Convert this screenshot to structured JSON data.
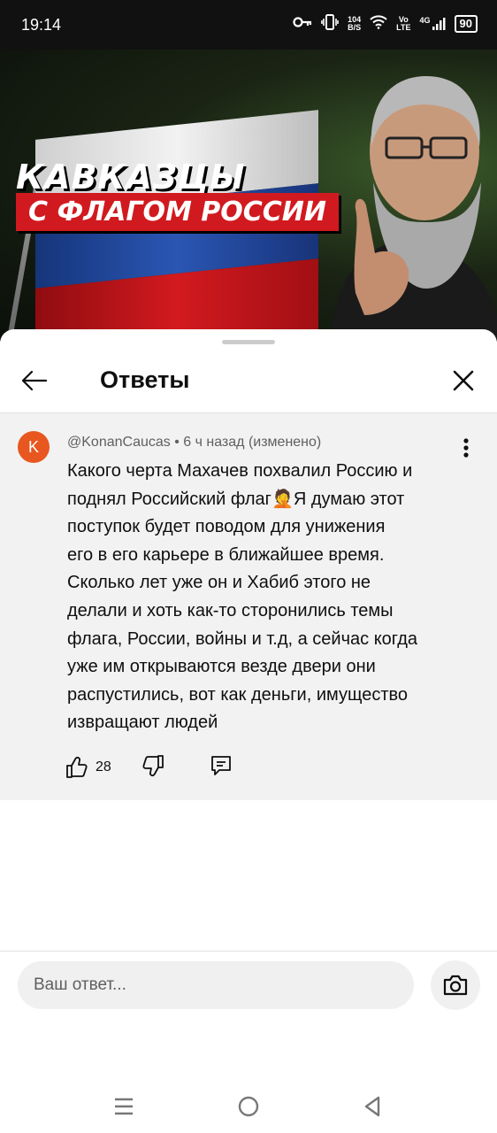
{
  "status_bar": {
    "time": "19:14",
    "net_speed_value": "104",
    "net_speed_unit": "B/S",
    "volte_top": "Vo",
    "volte_bottom": "LTE",
    "network": "4G",
    "battery": "90",
    "icons": [
      "key-icon",
      "vibrate-icon",
      "wifi-icon",
      "signal-icon",
      "battery-icon"
    ]
  },
  "video": {
    "headline_line1": "КАВКАЗЦЫ",
    "headline_line2": "С ФЛАГОМ РОССИИ",
    "flag_colors": [
      "#f2f2f2",
      "#2a56b3",
      "#d21a1f"
    ]
  },
  "sheet": {
    "title": "Ответы",
    "icons": [
      "back-arrow-icon",
      "close-icon"
    ]
  },
  "comment": {
    "avatar_letter": "K",
    "avatar_color": "#e8571f",
    "meta": "@KonanCaucas • 6 ч назад (изменено)",
    "text": "Какого черта Махачев похвалил Россию и\nподнял Российский флаг🤦Я думаю этот\nпоступок будет поводом для унижения\nего в его карьере в ближайшее время.\nСколько лет уже он и Хабиб этого не\nделали и хоть как-то сторонились темы\nфлага, России, войны и т.д, а сейчас когда\nуже им открываются везде двери они\nраспустились,  вот как деньги, имущество\nизвращают людей",
    "likes": "28",
    "icons": [
      "more-vert-icon",
      "thumbs-up-icon",
      "thumbs-down-icon",
      "reply-icon"
    ]
  },
  "reply": {
    "placeholder": "Ваш ответ...",
    "icons": [
      "camera-icon"
    ]
  },
  "nav_bar": {
    "icons": [
      "menu-icon",
      "home-circle-icon",
      "back-triangle-icon"
    ]
  }
}
